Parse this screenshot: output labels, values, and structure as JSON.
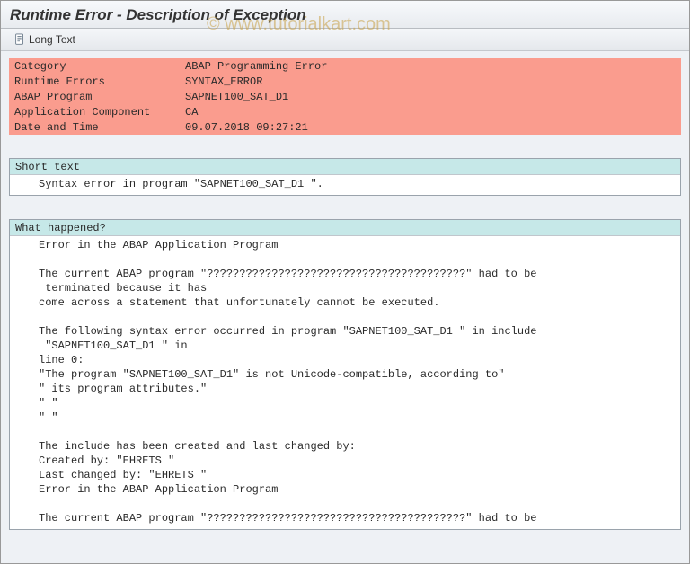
{
  "title": "Runtime Error - Description of Exception",
  "toolbar": {
    "long_text_label": "Long Text"
  },
  "info": {
    "rows": [
      {
        "label": "Category",
        "value": "ABAP Programming Error"
      },
      {
        "label": "Runtime Errors",
        "value": "SYNTAX_ERROR"
      },
      {
        "label": "ABAP Program",
        "value": "SAPNET100_SAT_D1"
      },
      {
        "label": "Application Component",
        "value": "CA"
      },
      {
        "label": "Date and Time",
        "value": "09.07.2018 09:27:21"
      }
    ]
  },
  "short_text": {
    "heading": "Short text",
    "line": "Syntax error in program \"SAPNET100_SAT_D1 \"."
  },
  "what_happened": {
    "heading": "What happened?",
    "lines": [
      "Error in the ABAP Application Program",
      "",
      "The current ABAP program \"????????????????????????????????????????\" had to be",
      " terminated because it has",
      "come across a statement that unfortunately cannot be executed.",
      "",
      "The following syntax error occurred in program \"SAPNET100_SAT_D1 \" in include",
      " \"SAPNET100_SAT_D1 \" in",
      "line 0:",
      "\"The program \"SAPNET100_SAT_D1\" is not Unicode-compatible, according to\"",
      "\" its program attributes.\"",
      "\" \"",
      "\" \"",
      "",
      "The include has been created and last changed by:",
      "Created by: \"EHRETS \"",
      "Last changed by: \"EHRETS \"",
      "Error in the ABAP Application Program",
      "",
      "The current ABAP program \"????????????????????????????????????????\" had to be"
    ]
  },
  "watermark": "© www.tutorialkart.com"
}
